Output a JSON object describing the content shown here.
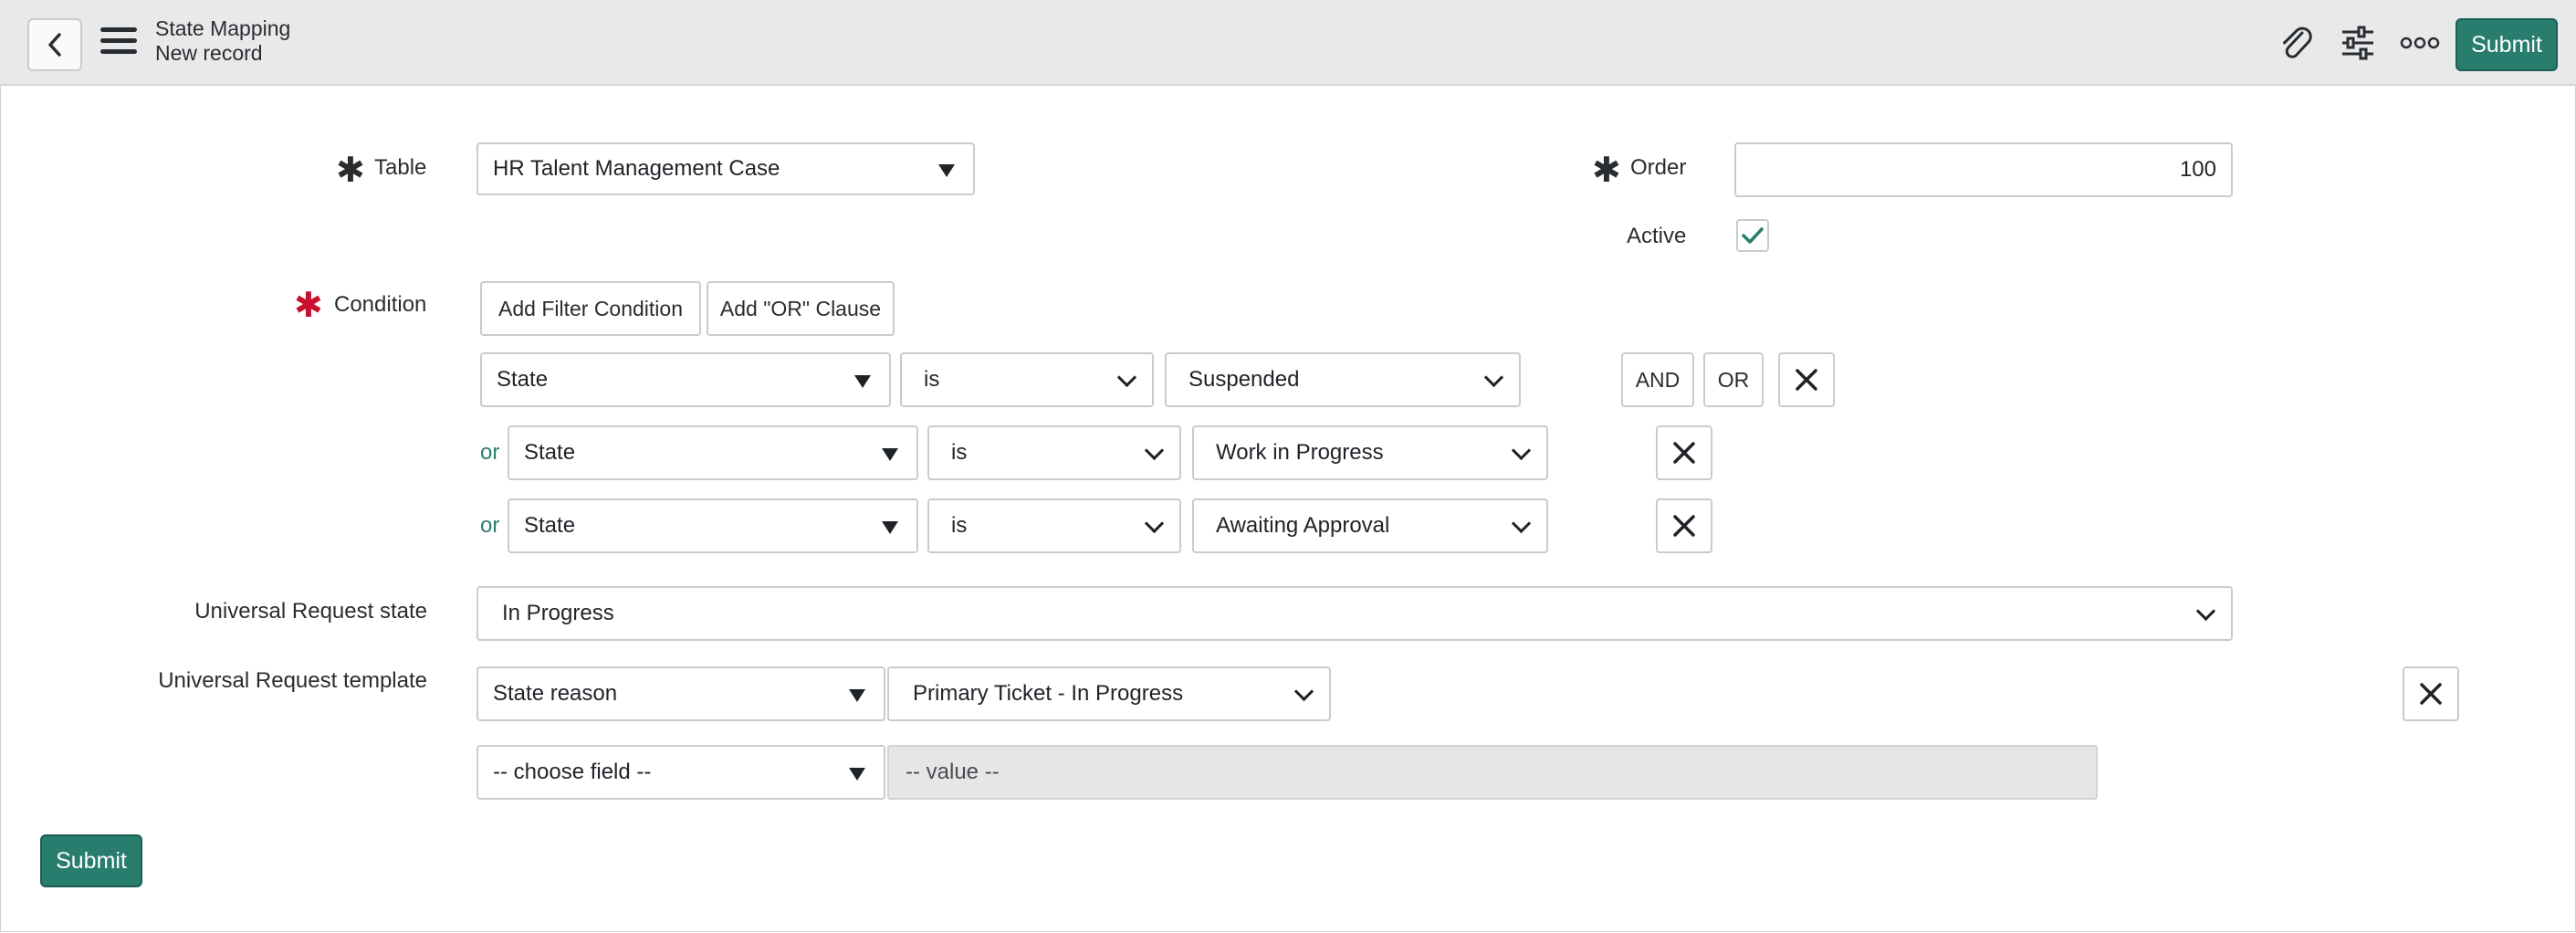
{
  "header": {
    "title": "State Mapping",
    "subtitle": "New record",
    "submit_label": "Submit",
    "icons": [
      "back-icon",
      "menu-icon",
      "attachment-icon",
      "settings-sliders-icon",
      "more-icon"
    ]
  },
  "form": {
    "table": {
      "label": "Table",
      "value": "HR Talent Management Case"
    },
    "order": {
      "label": "Order",
      "value": "100"
    },
    "active": {
      "label": "Active",
      "checked": true
    },
    "condition": {
      "label": "Condition",
      "add_filter_label": "Add Filter Condition",
      "add_or_label": "Add \"OR\" Clause",
      "and_label": "AND",
      "or_button_label": "OR",
      "rows": [
        {
          "prefix": "",
          "field": "State",
          "operator": "is",
          "value": "Suspended"
        },
        {
          "prefix": "or",
          "field": "State",
          "operator": "is",
          "value": "Work in Progress"
        },
        {
          "prefix": "or",
          "field": "State",
          "operator": "is",
          "value": "Awaiting Approval"
        }
      ]
    },
    "ur_state": {
      "label": "Universal Request state",
      "value": "In Progress"
    },
    "ur_template": {
      "label": "Universal Request template",
      "rows": [
        {
          "field": "State reason",
          "value": "Primary Ticket - In Progress"
        },
        {
          "field": "-- choose field --",
          "value": "-- value --"
        }
      ]
    }
  },
  "footer": {
    "submit_label": "Submit"
  },
  "colors": {
    "accent": "#287d6f",
    "required_red": "#c8102e",
    "or_green": "#2e7d6e"
  }
}
